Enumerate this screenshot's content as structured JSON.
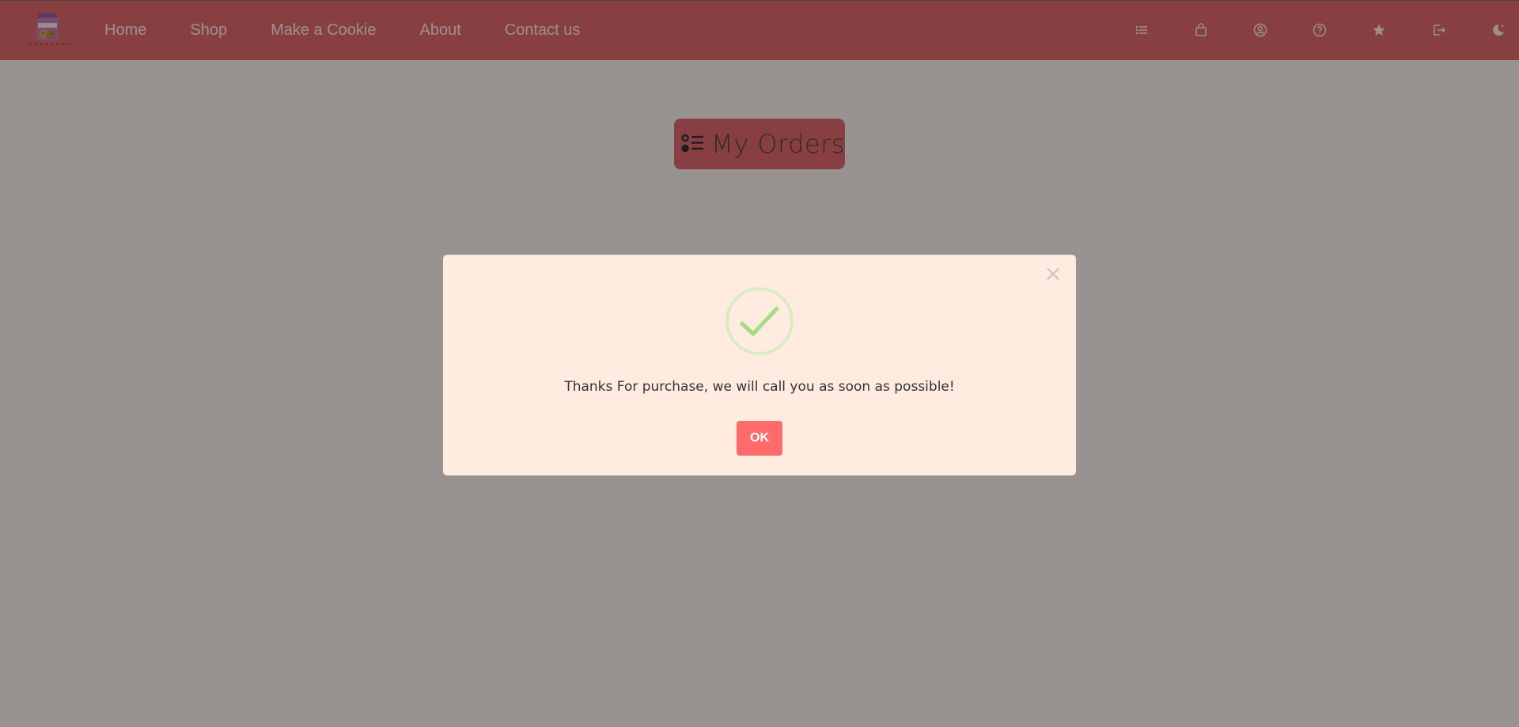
{
  "navbar": {
    "links": [
      "Home",
      "Shop",
      "Make a Cookie",
      "About",
      "Contact us"
    ],
    "icons": [
      "list-icon",
      "shopping-bag-icon",
      "user-circle-icon",
      "help-circle-icon",
      "star-icon",
      "logout-icon",
      "theme-toggle-icon"
    ],
    "colors": {
      "background": "#d64448",
      "link": "#fde7e4"
    }
  },
  "main": {
    "heading": "My Orders",
    "heading_icon": "list-icon"
  },
  "modal": {
    "close_label": "×",
    "icon": "success-check-icon",
    "message": "Thanks For purchase, we will call you as soon as possible!",
    "ok_label": "OK",
    "colors": {
      "background": "#ffebe0",
      "button": "#ff6b6b",
      "check": "#a5dc86"
    }
  }
}
